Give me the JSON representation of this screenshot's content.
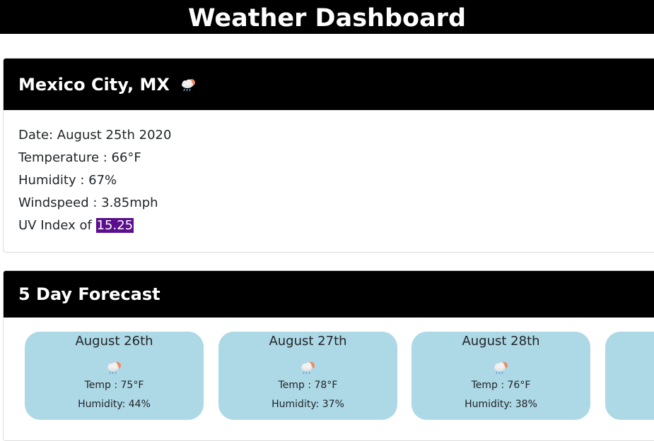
{
  "header": {
    "title": "Weather Dashboard"
  },
  "current": {
    "city": "Mexico City, MX",
    "icon": "cloud-rain-sun-icon",
    "date_line": "Date: August 25th 2020",
    "temp_line": "Temperature : 66°F",
    "humidity_line": "Humidity : 67%",
    "wind_line": "Windspeed : 3.85mph",
    "uv_label": "UV Index of ",
    "uv_value": "15.25",
    "uv_color": "#5b0e8e"
  },
  "forecast": {
    "title": "5 Day Forecast",
    "card_color": "#add8e6",
    "days": [
      {
        "date": "August 26th",
        "icon": "cloud-rain-sun-icon",
        "temp": "Temp : 75°F",
        "humidity": "Humidity: 44%"
      },
      {
        "date": "August 27th",
        "icon": "cloud-rain-sun-icon",
        "temp": "Temp : 78°F",
        "humidity": "Humidity: 37%"
      },
      {
        "date": "August 28th",
        "icon": "cloud-rain-sun-icon",
        "temp": "Temp : 76°F",
        "humidity": "Humidity: 38%"
      }
    ]
  }
}
